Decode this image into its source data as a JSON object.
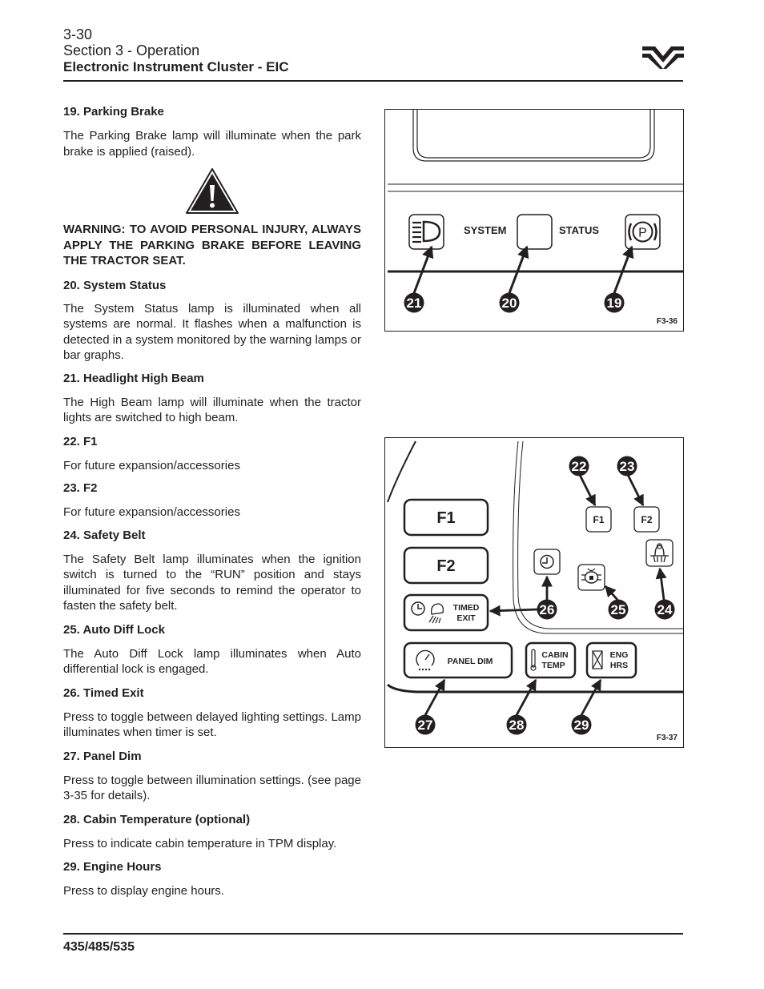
{
  "header": {
    "page_number": "3-30",
    "section": "Section 3 - Operation",
    "title": "Electronic Instrument Cluster - EIC"
  },
  "logo": {
    "icon": "brand-logo-icon"
  },
  "items": [
    {
      "heading": "19. Parking Brake",
      "body": "The Parking Brake lamp will illuminate when the park brake is applied (raised)."
    },
    {
      "heading": "20. System Status",
      "body": "The System Status lamp is illuminated when all systems are normal. It flashes when a malfunction is detected in a system monitored by the warning lamps or bar graphs."
    },
    {
      "heading": "21. Headlight High Beam",
      "body": "The High Beam lamp will illuminate when the tractor lights are switched to high beam."
    },
    {
      "heading": "22. F1",
      "body": "For future expansion/accessories"
    },
    {
      "heading": "23. F2",
      "body": "For future expansion/accessories"
    },
    {
      "heading": "24. Safety Belt",
      "body": "The Safety Belt lamp illuminates when the ignition switch is turned to the “RUN” position and stays illuminated for five seconds to remind the operator to fasten the safety belt."
    },
    {
      "heading": "25. Auto Diff Lock",
      "body": "The Auto Diff Lock lamp illuminates when Auto differential lock is engaged."
    },
    {
      "heading": "26. Timed Exit",
      "body": "Press to toggle between delayed lighting settings. Lamp illuminates when timer is set."
    },
    {
      "heading": "27. Panel Dim",
      "body": "Press to toggle between illumination settings. (see page 3-35 for details)."
    },
    {
      "heading": "28. Cabin Temperature (optional)",
      "body": "Press to indicate cabin temperature in TPM display."
    },
    {
      "heading": "29. Engine Hours",
      "body": "Press to display engine hours."
    }
  ],
  "warning": {
    "icon": "warning-triangle-icon",
    "text": "WARNING: TO AVOID PERSONAL INJURY, ALWAYS APPLY THE PARKING BRAKE BEFORE LEAVING THE TRACTOR SEAT."
  },
  "figure1": {
    "id": "F3-36",
    "labels": {
      "system": "SYSTEM",
      "status": "STATUS"
    },
    "callouts": [
      "21",
      "20",
      "19"
    ],
    "icons": [
      "high-beam-icon",
      "system-status-lamp",
      "parking-brake-icon"
    ]
  },
  "figure2": {
    "id": "F3-37",
    "buttons": {
      "f1": "F1",
      "f2": "F2",
      "timed": "TIMED",
      "exit": "EXIT",
      "panel_dim": "PANEL DIM",
      "cabin": "CABIN",
      "temp": "TEMP",
      "eng": "ENG",
      "hrs": "HRS"
    },
    "lamps": {
      "f1": "F1",
      "f2": "F2"
    },
    "callouts": [
      "22",
      "23",
      "24",
      "25",
      "26",
      "27",
      "28",
      "29"
    ]
  },
  "footer": {
    "models": "435/485/535"
  }
}
